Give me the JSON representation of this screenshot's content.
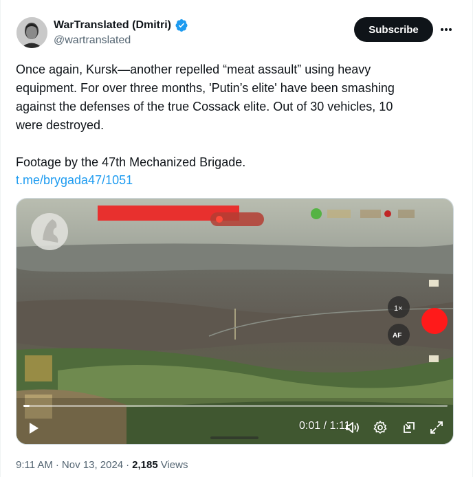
{
  "author": {
    "display_name": "WarTranslated (Dmitri)",
    "handle": "@wartranslated",
    "verified": true
  },
  "subscribe_label": "Subscribe",
  "post": {
    "text": "Once again, Kursk—another repelled “meat assault” using heavy\nequipment. For over three months, 'Putin’s elite' have been smashing\nagainst the defenses of the true Cossack elite. Out of 30 vehicles, 10\nwere destroyed.\n\nFootage by the 47th Mechanized Brigade.",
    "link": "t.me/brygada47/1051"
  },
  "video": {
    "current_time": "0:01",
    "duration": "1:11",
    "time_display": "0:01 / 1:11",
    "progress_fraction": 0.014,
    "hud_zoom": "1×",
    "hud_af": "AF"
  },
  "meta": {
    "time": "9:11 AM",
    "date": "Nov 13, 2024",
    "views_count": "2,185",
    "views_label": "Views"
  },
  "colors": {
    "link": "#1d9bf0",
    "verified": "#1d9bf0",
    "record": "#ff1a1a"
  },
  "icons": [
    "verified-badge-icon",
    "more-icon",
    "play-icon",
    "volume-icon",
    "settings-icon",
    "pip-icon",
    "fullscreen-icon"
  ]
}
